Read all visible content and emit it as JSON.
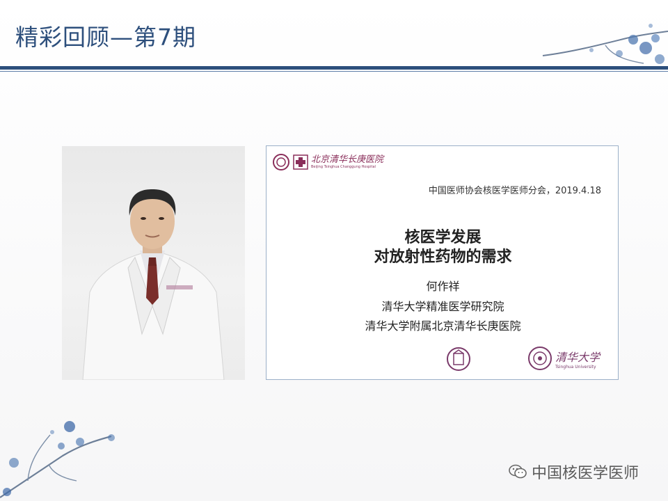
{
  "title": "精彩回顾—第7期",
  "slide": {
    "hospital_name_cn": "北京清华长庚医院",
    "hospital_name_en": "Beijing Tsinghua Changgung Hospital",
    "meta": "中国医师协会核医学医师分会，2019.4.18",
    "heading_line1": "核医学发展",
    "heading_line2": "对放射性药物的需求",
    "speaker": "何作祥",
    "affiliation1": "清华大学精准医学研究院",
    "affiliation2": "清华大学附属北京清华长庚医院",
    "university_cn": "清华大学",
    "university_en": "Tsinghua University"
  },
  "watermark": {
    "icon": "wechat-icon",
    "text": "中国核医学医师"
  },
  "colors": {
    "brand_blue": "#2d4f7c",
    "hospital_purple": "#8a2e5a"
  }
}
